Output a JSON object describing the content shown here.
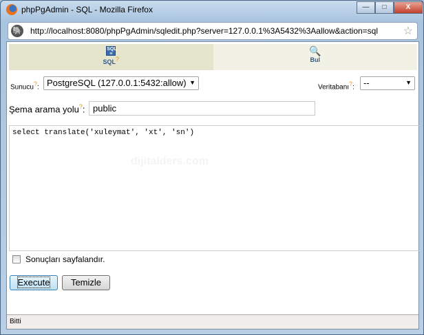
{
  "window": {
    "title": "phpPgAdmin - SQL - Mozilla Firefox",
    "minimize": "—",
    "maximize": "□",
    "close": "X"
  },
  "urlbar": {
    "url": "http://localhost:8080/phpPgAdmin/sqledit.php?server=127.0.0.1%3A5432%3Aallow&action=sql"
  },
  "tabs": [
    {
      "label": "SQL",
      "help": "?",
      "selected": true
    },
    {
      "label": "Bul",
      "selected": false
    }
  ],
  "form": {
    "server_label": "Sunucu",
    "server_help": "?",
    "server_value": "PostgreSQL (127.0.0.1:5432:allow)",
    "db_label": "Veritabanı",
    "db_help": "?",
    "db_value": "--",
    "schema_label": "Şema arama yolu",
    "schema_help": "?",
    "schema_value": "public",
    "query": "select translate('xuleymat', 'xt', 'sn')",
    "watermark": "dijitalders.com",
    "paginate_label": "Sonuçları sayfalandır.",
    "paginate_checked": false,
    "execute": "Execute",
    "clear": "Temizle"
  },
  "status": "Bitti"
}
